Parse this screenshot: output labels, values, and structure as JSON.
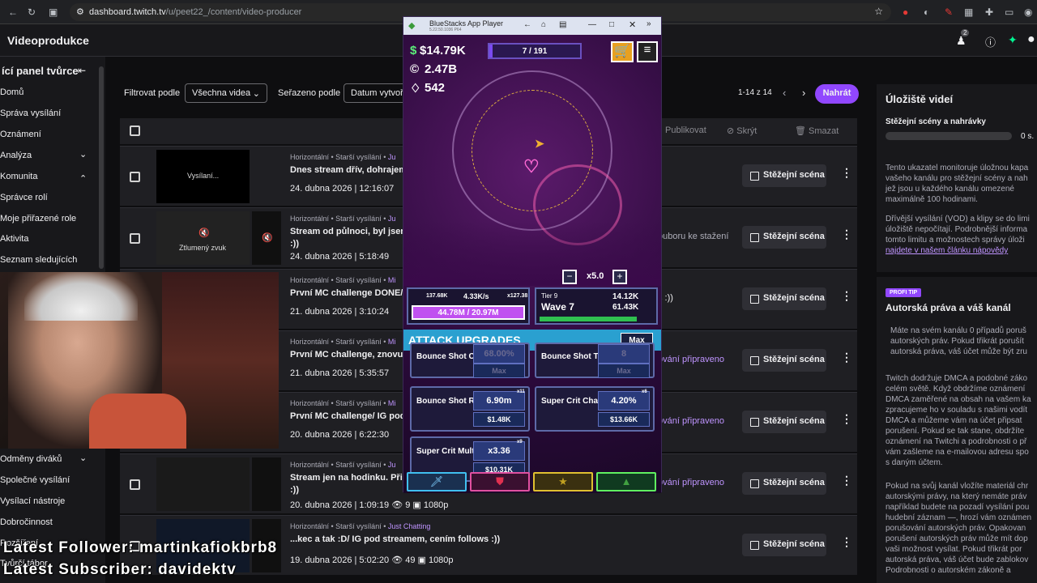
{
  "browser": {
    "url_host": "dashboard.twitch.tv",
    "url_path": "/u/peet22_/content/video-producer",
    "ext_badge": "2"
  },
  "header": {
    "title": "Videoprodukce",
    "notif_count": "2"
  },
  "sidebar": {
    "heading": "ící panel tvůrce",
    "collapse": "⇤",
    "items": [
      {
        "label": "Domů"
      },
      {
        "label": "Správa vysílání"
      },
      {
        "label": "Oznámení"
      },
      {
        "label": "Analýza",
        "chev": "⌄"
      },
      {
        "label": "Komunita",
        "chev": "⌃"
      },
      {
        "label": "Správce rolí"
      },
      {
        "label": "Moje přiřazené role"
      },
      {
        "label": "Aktivita"
      },
      {
        "label": "Seznam sledujících"
      }
    ],
    "bottom_items": [
      {
        "label": "Odměny diváků",
        "chev": "⌄"
      },
      {
        "label": "Společné vysílání"
      },
      {
        "label": "Vysílací nástroje"
      },
      {
        "label": "Dobročinnost"
      },
      {
        "label": "Rozšíření"
      },
      {
        "label": "Tvůrčí tábor"
      }
    ]
  },
  "toolbar": {
    "filter_label": "Filtrovat podle",
    "filter_value": "Všechna videa",
    "sort_label": "Seřazeno podle",
    "sort_value": "Datum vytvoř",
    "pagination": "1-14 z 14",
    "upload": "Nahrát",
    "publish": "Publikovat",
    "hide": "Skrýt",
    "delete": "Smazat"
  },
  "rows": [
    {
      "thumb": "Vysílaní...",
      "meta": "Horizontální • Starší vysílání • ",
      "cat": "Ju",
      "title": "Dnes stream dřív, dohrajeme",
      "title2": "",
      "date": "24. dubna 2026 | 12:16:07",
      "status": "",
      "highlight": "Stěžejní scéna"
    },
    {
      "thumb": "Ztlumený zvuk",
      "meta": "Horizontální • Starší vysílání • ",
      "cat": "Ju",
      "title": "Stream od půlnoci, byl jsem ",
      "title2": ":))",
      "date": "24. dubna 2026 | 5:18:49",
      "status": "ouboru ke stažení",
      "highlight": "Stěžejní scéna"
    },
    {
      "thumb": "",
      "meta": "Horizontální • Starší vysílání • ",
      "cat": "Mi",
      "title": "První MC challenge DONE/S",
      "title2": "",
      "date": "21. dubna 2026 | 3:10:24",
      "status": "s :))",
      "highlight": "Stěžejní scéna"
    },
    {
      "thumb": "",
      "meta": "Horizontální • Starší vysílání • ",
      "cat": "Mi",
      "title": "První MC challenge, znovu a",
      "title2": "",
      "date": "21. dubna 2026 | 5:35:57",
      "status": "ování připraveno",
      "highlight": "Stěžejní scéna"
    },
    {
      "thumb": "",
      "meta": "Horizontální • Starší vysílání • ",
      "cat": "Mi",
      "title": "První MC challenge/ IG pod s",
      "title2": "",
      "date": "20. dubna 2026 | 6:22:30",
      "status": "ování připraveno",
      "highlight": "Stěžejní scéna"
    },
    {
      "thumb": "",
      "meta": "Horizontální • Starší vysílání • ",
      "cat": "Ju",
      "title": "Stream jen na hodinku. Připra",
      "title2": ":))",
      "date": "20. dubna 2026 | 1:09:19  👁 9  ▣ 1080p",
      "status": "ování připraveno",
      "highlight": "Stěžejní scéna"
    },
    {
      "thumb": "",
      "meta": "Horizontální • Starší vysílání • ",
      "cat": "Just Chatting",
      "title": "...kec a tak :D/ IG pod streamem, cením follows :))",
      "title2": "",
      "date": "19. dubna 2026 | 5:02:20  👁 49  ▣ 1080p",
      "status": "",
      "highlight": "Stěžejní scéna"
    }
  ],
  "right_panel": {
    "title": "Úložiště videí",
    "sub": "Stěžejní scény a nahrávky",
    "sub_val": "0 s.",
    "p1": [
      "Tento ukazatel monitoruje úložnou kapa",
      "vašeho kanálu pro stěžejní scény a nah",
      "jež jsou u každého kanálu omezené",
      "maximálně 100 hodinami."
    ],
    "p2": [
      "Dřívější vysílání (VOD) a klipy se do limi",
      "úložiště nepočítají. Podrobnější informa",
      "tomto limitu a možnostech správy úloži"
    ],
    "p2_link": "najdete v našem článku nápovědy",
    "badge": "PROFI TIP",
    "title2": "Autorská práva a váš kanál",
    "p3": [
      "Máte na svém kanálu 0 případů poruš",
      "autorských práv. Pokud třikrát porušít",
      "autorská práva, váš účet může být zru"
    ],
    "p4": [
      "Twitch dodržuje DMCA a podobné záko",
      "celém světě. Když obdržíme oznámení",
      "DMCA zaměřené na obsah na vašem ka",
      "zpracujeme ho v souladu s našimi vodít",
      "DMCA a můžeme vám na účet připsat",
      "porušení. Pokud se tak stane, obdržíte",
      "oznámení na Twitchi a podrobnosti o př",
      "vám zašleme na e-mailovou adresu spo",
      "s daným účtem."
    ],
    "p5": [
      "Pokud na svůj kanál vložíte materiál chr",
      "autorskými právy, na který nemáte práv",
      "například budete na pozadí vysílání pou",
      "hudební záznam —, hrozí vám oznámen",
      "porušování autorských práv. Opakovan",
      "porušení autorských práv může mít dop",
      "vaši možnost vysílat. Pokud třikrát por",
      "autorská práva, váš účet bude zablokov",
      "Podrobnosti o autorském zákoně a"
    ]
  },
  "bluestacks": {
    "title": "BlueStacks App Player",
    "version": "5.22.50.1036 P64",
    "cash": "$14.79K",
    "coins": "2.47B",
    "gems": "542",
    "wave_progress": "7 / 191",
    "speed": "x5.0",
    "stats": {
      "s1": "137.68K",
      "s2": "4.33K/s",
      "s3": "x127.38",
      "hp": "44.78M / 20.97M",
      "tier": "Tier 9",
      "wave": "Wave 7",
      "t1": "14.12K",
      "t2": "61.43K"
    },
    "section": "ATTACK UPGRADES",
    "max_btn": "Max",
    "upgrades": [
      {
        "name": "Bounce Shot Chance",
        "value": "68.00%",
        "cost": "Max"
      },
      {
        "name": "Bounce Shot Targets",
        "value": "8",
        "cost": "Max"
      },
      {
        "name": "Bounce Shot Range",
        "value": "6.90m",
        "cost": "$1.48K",
        "mult": "x11"
      },
      {
        "name": "Super Crit Chance",
        "value": "4.20%",
        "cost": "$13.66K",
        "mult": "x6"
      },
      {
        "name": "Super Crit Mult",
        "value": "x3.36",
        "cost": "$10.31K",
        "mult": "x9"
      }
    ]
  },
  "overlay": {
    "follower": "Latest Follower: martinkafiokbrb8",
    "subscriber": "Latest Subscriber: davidektv"
  }
}
